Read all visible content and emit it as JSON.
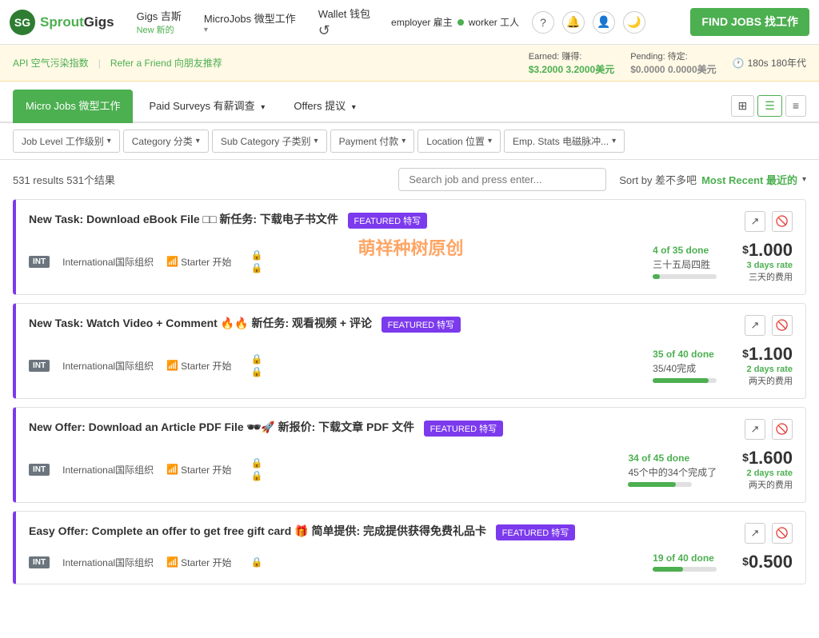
{
  "logo": {
    "icon_text": "SG",
    "name": "SproutGigs",
    "name_color": "Sprout",
    "name_suffix": "Gigs"
  },
  "navbar": {
    "gigs_label": "Gigs 吉斯",
    "gigs_sub": "New 新的",
    "microjobs_label": "MicroJobs 微型工作",
    "wallet_label": "Wallet 钱包",
    "employer_label": "employer 雇主",
    "worker_label": "worker 工人",
    "find_jobs_label": "FIND JOBS 找工作"
  },
  "info_bar": {
    "api_label": "API 空气污染指数",
    "refer_label": "Refer a Friend 向朋友推荐",
    "earned_label": "Earned: 赚得:",
    "earned_val": "$3.2000",
    "earned_cn": "3.2000美元",
    "pending_label": "Pending: 待定:",
    "pending_val": "$0.0000",
    "pending_cn": "0.0000美元",
    "time_val": "180s 180年代"
  },
  "tabs": {
    "micro_jobs": "Micro Jobs 微型工作",
    "paid_surveys": "Paid Surveys 有薪调查",
    "offers": "Offers 提议"
  },
  "filters": {
    "job_level": "Job Level 工作级别",
    "category": "Category 分类",
    "sub_category": "Sub Category 子类别",
    "payment": "Payment 付款",
    "location": "Location 位置",
    "emp_stats": "Emp. Stats 电磁脉冲..."
  },
  "results": {
    "count": "531 results",
    "count_cn": "531个结果",
    "search_placeholder": "Search job and press enter...",
    "sort_label": "Sort by 差不多吧",
    "sort_active": "Most Recent 最近的"
  },
  "jobs": [
    {
      "title": "New Task: Download eBook File □□ 新任务: 下载电子书文件",
      "featured": "FEATURED 特写",
      "int": "INT",
      "org": "International国际组织",
      "level": "Starter 开始",
      "progress_done": "4 of 35 done",
      "progress_cn": "三十五局四胜",
      "progress_pct": 11,
      "price": "1.000",
      "rate": "3 days rate",
      "rate_cn": "三天的费用"
    },
    {
      "title": "New Task: Watch Video + Comment 🔥🔥 新任务: 观看视频 + 评论",
      "featured": "FEATURED 特写",
      "int": "INT",
      "org": "International国际组织",
      "level": "Starter 开始",
      "progress_done": "35 of 40 done",
      "progress_cn": "35/40完成",
      "progress_pct": 87,
      "price": "1.100",
      "rate": "2 days rate",
      "rate_cn": "两天的费用"
    },
    {
      "title": "New Offer: Download an Article PDF File 🕶🚀 新报价: 下载文章 PDF 文件",
      "featured": "FEATURED 特写",
      "int": "INT",
      "org": "International国际组织",
      "level": "Starter 开始",
      "progress_done": "34 of 45 done",
      "progress_cn": "45个中的34个完成了",
      "progress_pct": 75,
      "price": "1.600",
      "rate": "2 days rate",
      "rate_cn": "两天的费用"
    },
    {
      "title": "Easy Offer: Complete an offer to get free gift card 🎁 简单提供: 完成提供获得免费礼品卡",
      "featured": "FEATURED 特写",
      "int": "INT",
      "org": "International国际组织",
      "level": "Starter 开始",
      "progress_done": "19 of 40 done",
      "progress_cn": "",
      "progress_pct": 47,
      "price": "0.500",
      "rate": "",
      "rate_cn": ""
    }
  ],
  "watermark": "萌祥种树原创"
}
